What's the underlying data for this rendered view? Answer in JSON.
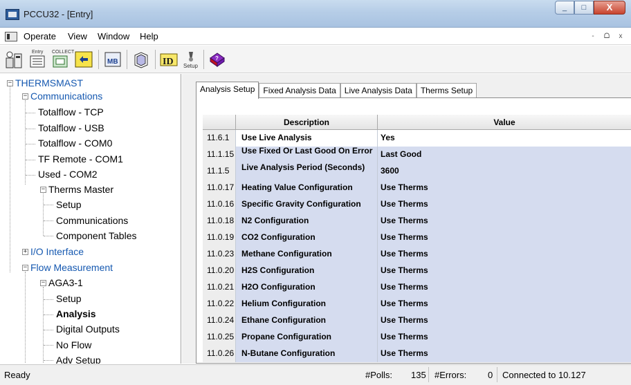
{
  "window": {
    "title": "PCCU32 - [Entry]",
    "controls": [
      "_",
      "□",
      "X"
    ]
  },
  "menu": {
    "items": [
      "Operate",
      "View",
      "Window",
      "Help"
    ],
    "mdi_controls": [
      "-",
      "ᗝ",
      "x"
    ]
  },
  "toolbar": {
    "entry_caption": "Entry",
    "collect_caption": "COLLECT",
    "mb_label": "MB",
    "id_label": "ID",
    "setup_caption": "Setup",
    "icons": [
      "operator-icon",
      "entry-icon",
      "collect-icon",
      "refresh-icon",
      "modbus-icon",
      "book-icon",
      "id-icon",
      "setup-icon",
      "help-icon"
    ]
  },
  "tree": {
    "items": [
      {
        "label": "THERMSMAST",
        "style": "blue"
      },
      {
        "label": "Communications",
        "style": "blue"
      },
      {
        "label": "Totalflow - TCP",
        "style": "normal"
      },
      {
        "label": "Totalflow - USB",
        "style": "normal"
      },
      {
        "label": "Totalflow - COM0",
        "style": "normal"
      },
      {
        "label": "TF Remote - COM1",
        "style": "normal"
      },
      {
        "label": "Used - COM2",
        "style": "normal"
      },
      {
        "label": "Therms Master",
        "style": "normal"
      },
      {
        "label": "Setup",
        "style": "normal"
      },
      {
        "label": "Communications",
        "style": "normal"
      },
      {
        "label": "Component Tables",
        "style": "normal"
      },
      {
        "label": "I/O Interface",
        "style": "blue"
      },
      {
        "label": "Flow Measurement",
        "style": "blue"
      },
      {
        "label": "AGA3-1",
        "style": "normal"
      },
      {
        "label": "Setup",
        "style": "normal"
      },
      {
        "label": "Analysis",
        "style": "bold"
      },
      {
        "label": "Digital Outputs",
        "style": "normal"
      },
      {
        "label": "No Flow",
        "style": "normal"
      },
      {
        "label": "Adv Setup",
        "style": "normal"
      }
    ]
  },
  "tabs": [
    {
      "label": "Analysis Setup",
      "active": true
    },
    {
      "label": "Fixed Analysis Data",
      "active": false
    },
    {
      "label": "Live Analysis Data",
      "active": false
    },
    {
      "label": "Therms Setup",
      "active": false
    }
  ],
  "table": {
    "headers": {
      "num": "",
      "description": "Description",
      "value": "Value"
    },
    "rows": [
      {
        "num": "11.6.1",
        "description": "Use Live Analysis",
        "value": "Yes"
      },
      {
        "num": "11.1.15",
        "description": "Use Fixed Or Last Good On Error",
        "value": "Last Good"
      },
      {
        "num": "11.1.5",
        "description": "Live Analysis Period (Seconds)",
        "value": "3600"
      },
      {
        "num": "11.0.17",
        "description": "Heating Value Configuration",
        "value": "Use Therms"
      },
      {
        "num": "11.0.16",
        "description": "Specific Gravity Configuration",
        "value": "Use Therms"
      },
      {
        "num": "11.0.18",
        "description": "N2 Configuration",
        "value": "Use Therms"
      },
      {
        "num": "11.0.19",
        "description": "CO2 Configuration",
        "value": "Use Therms"
      },
      {
        "num": "11.0.23",
        "description": "Methane Configuration",
        "value": "Use Therms"
      },
      {
        "num": "11.0.20",
        "description": "H2S Configuration",
        "value": "Use Therms"
      },
      {
        "num": "11.0.21",
        "description": "H2O Configuration",
        "value": "Use Therms"
      },
      {
        "num": "11.0.22",
        "description": "Helium Configuration",
        "value": "Use Therms"
      },
      {
        "num": "11.0.24",
        "description": "Ethane Configuration",
        "value": "Use Therms"
      },
      {
        "num": "11.0.25",
        "description": "Propane Configuration",
        "value": "Use Therms"
      },
      {
        "num": "11.0.26",
        "description": "N-Butane Configuration",
        "value": "Use Therms"
      }
    ]
  },
  "status": {
    "ready": "Ready",
    "polls_label": "#Polls:",
    "polls_value": "135",
    "errors_label": "#Errors:",
    "errors_value": "0",
    "connection": "Connected to 10.127"
  },
  "colors": {
    "selected_row": "#d5dcef",
    "tree_link": "#1558b0",
    "close_button": "#c8442e"
  }
}
